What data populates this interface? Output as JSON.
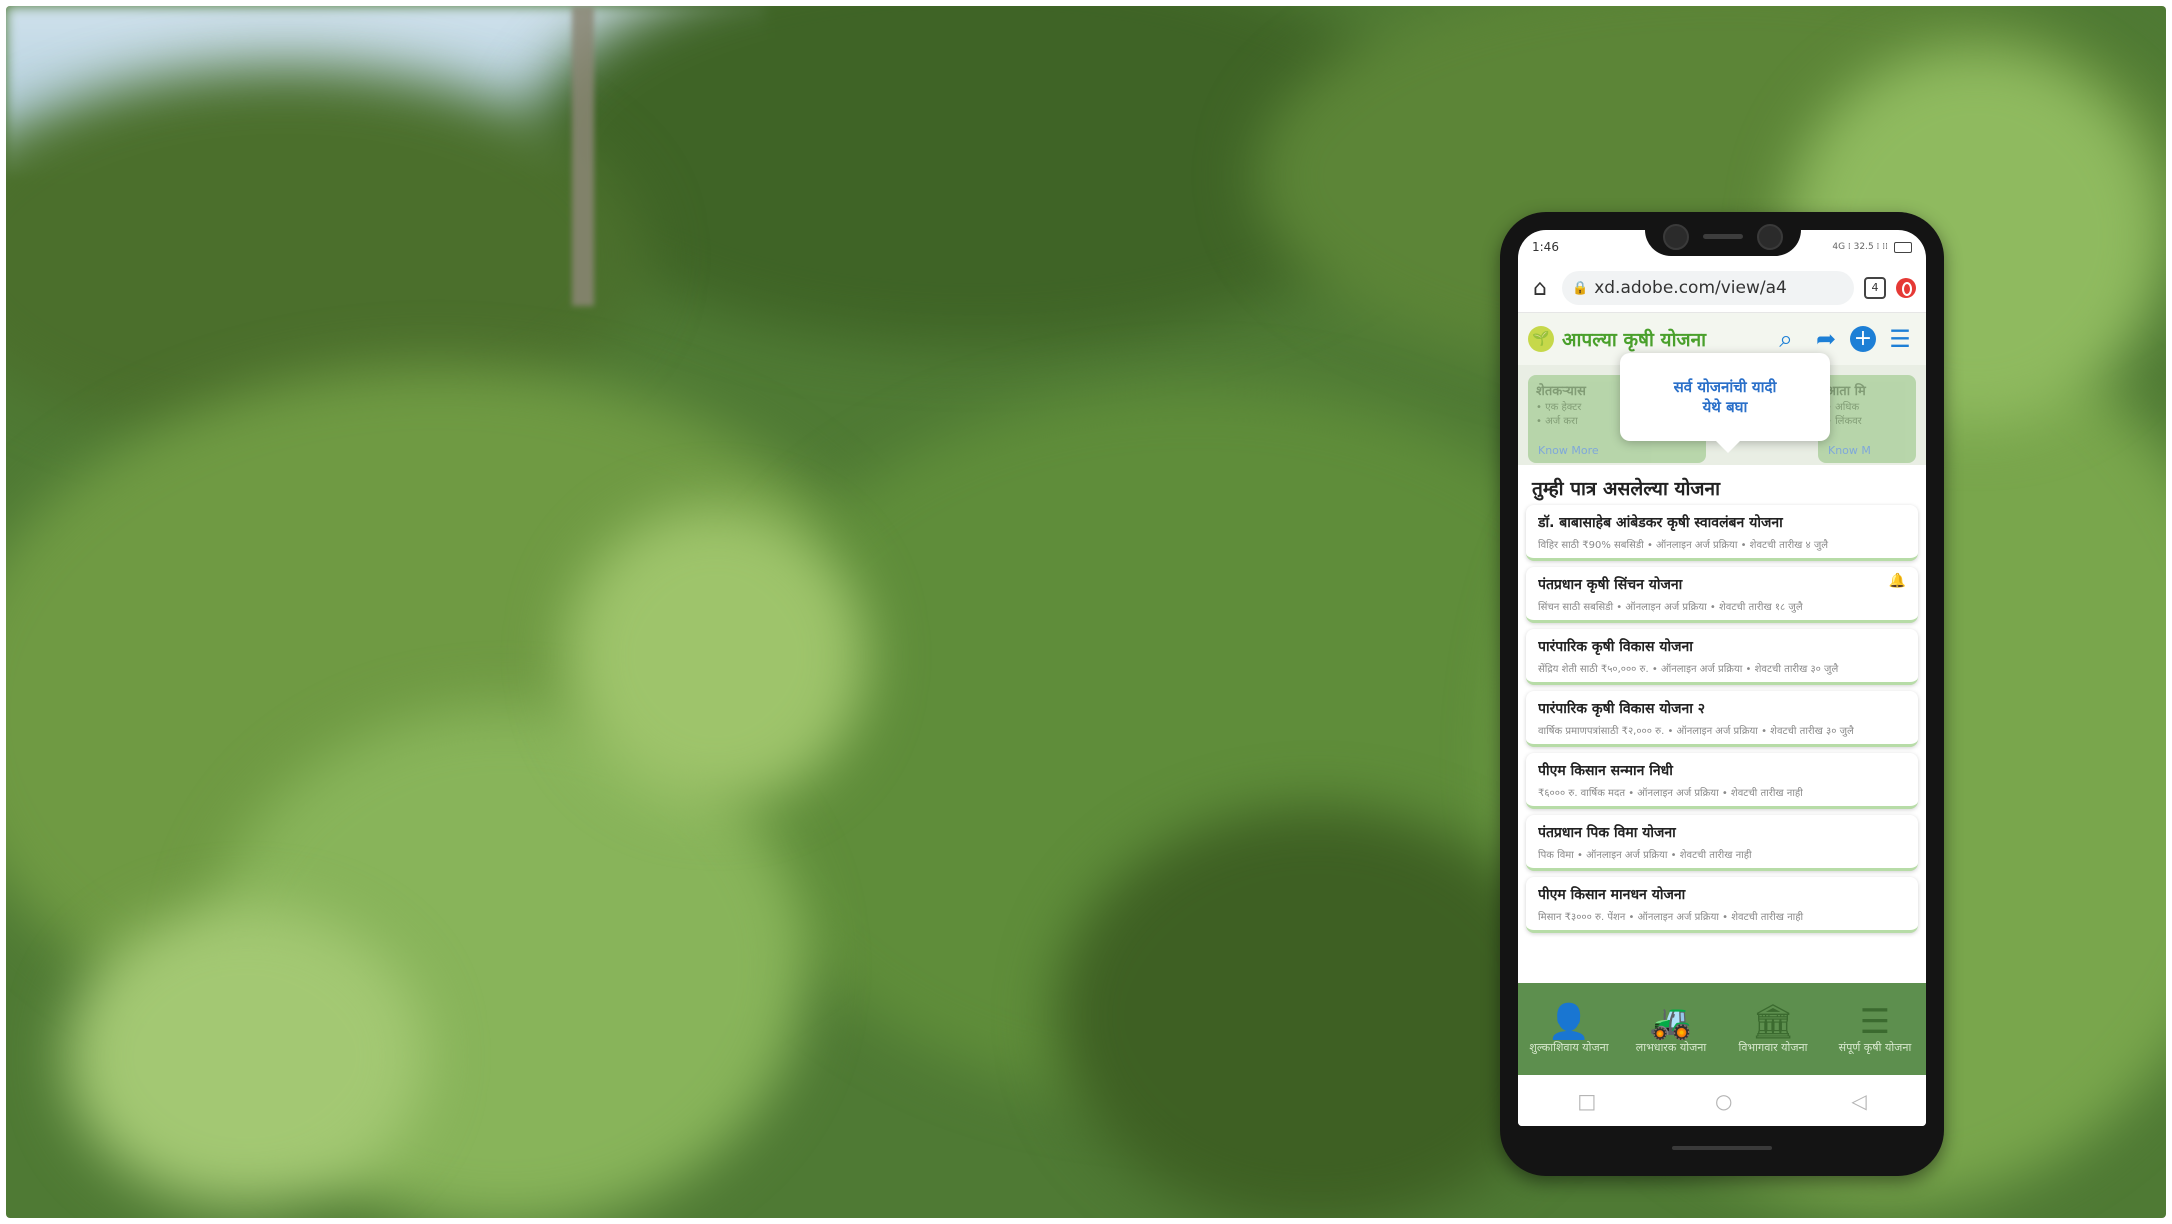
{
  "status_bar": {
    "time": "1:46",
    "indicators": "4G ⁞ 32.5 ⁞ ⁞⁞",
    "battery_icon": "battery-icon"
  },
  "browser": {
    "url": "xd.adobe.com/view/a4",
    "tab_count": "4"
  },
  "app": {
    "title": "आपल्या कृषी योजना",
    "icons": [
      "search-icon",
      "share-icon",
      "add-icon",
      "menu-icon"
    ],
    "accent_color": "#4aa02c"
  },
  "banners": {
    "left_title": "शेतकऱ्यास",
    "left_text": "• एक हेक्टर\n• अर्ज करा",
    "left_link": "Know More",
    "right_title": "आता मि",
    "right_text": "• अधिक\n• लिंकवर",
    "right_link": "Know M"
  },
  "tooltip": {
    "line1": "सर्व योजनांची यादी",
    "line2": "येथे बघा"
  },
  "section": {
    "title": "तुम्ही पात्र असलेल्या योजना"
  },
  "schemes": [
    {
      "title": "डॉ. बाबासाहेब आंबेडकर कृषी स्वावलंबन योजना",
      "meta": "विहिर साठी ₹90% सबसिडी • ऑनलाइन अर्ज प्रक्रिया • शेवटची तारीख ४ जुलै",
      "bell": ""
    },
    {
      "title": "पंतप्रधान कृषी सिंचन योजना",
      "meta": "सिंचन साठी सबसिडी • ऑनलाइन अर्ज प्रक्रिया • शेवटची तारीख १८ जुलै",
      "bell": "🔔"
    },
    {
      "title": "पारंपारिक कृषी विकास योजना",
      "meta": "सेंद्रिय शेती साठी ₹५०,००० रु. • ऑनलाइन अर्ज प्रक्रिया • शेवटची तारीख ३० जुलै",
      "bell": ""
    },
    {
      "title": "पारंपारिक कृषी विकास योजना २",
      "meta": "वार्षिक प्रमाणपत्रांसाठी ₹२,००० रु. • ऑनलाइन अर्ज प्रक्रिया • शेवटची तारीख ३० जुलै",
      "bell": ""
    },
    {
      "title": "पीएम किसान सन्मान निधी",
      "meta": "₹६००० रु. वार्षिक मदत • ऑनलाइन अर्ज प्रक्रिया • शेवटची तारीख नाही",
      "bell": ""
    },
    {
      "title": "पंतप्रधान पिक विमा योजना",
      "meta": "पिक विमा • ऑनलाइन अर्ज प्रक्रिया • शेवटची तारीख नाही",
      "bell": ""
    },
    {
      "title": "पीएम किसान मानधन योजना",
      "meta": "मिसान ₹३००० रु. पेंशन • ऑनलाइन अर्ज प्रक्रिया • शेवटची तारीख नाही",
      "bell": ""
    }
  ],
  "bottom_nav": [
    {
      "label": "शुल्काशिवाय योजना",
      "icon": "farmer-icon"
    },
    {
      "label": "लाभधारक योजना",
      "icon": "tractor-icon"
    },
    {
      "label": "विभागवार योजना",
      "icon": "bank-icon"
    },
    {
      "label": "संपूर्ण कृषी योजना",
      "icon": "document-icon"
    }
  ],
  "system_nav": [
    "square-icon",
    "circle-icon",
    "back-icon"
  ]
}
